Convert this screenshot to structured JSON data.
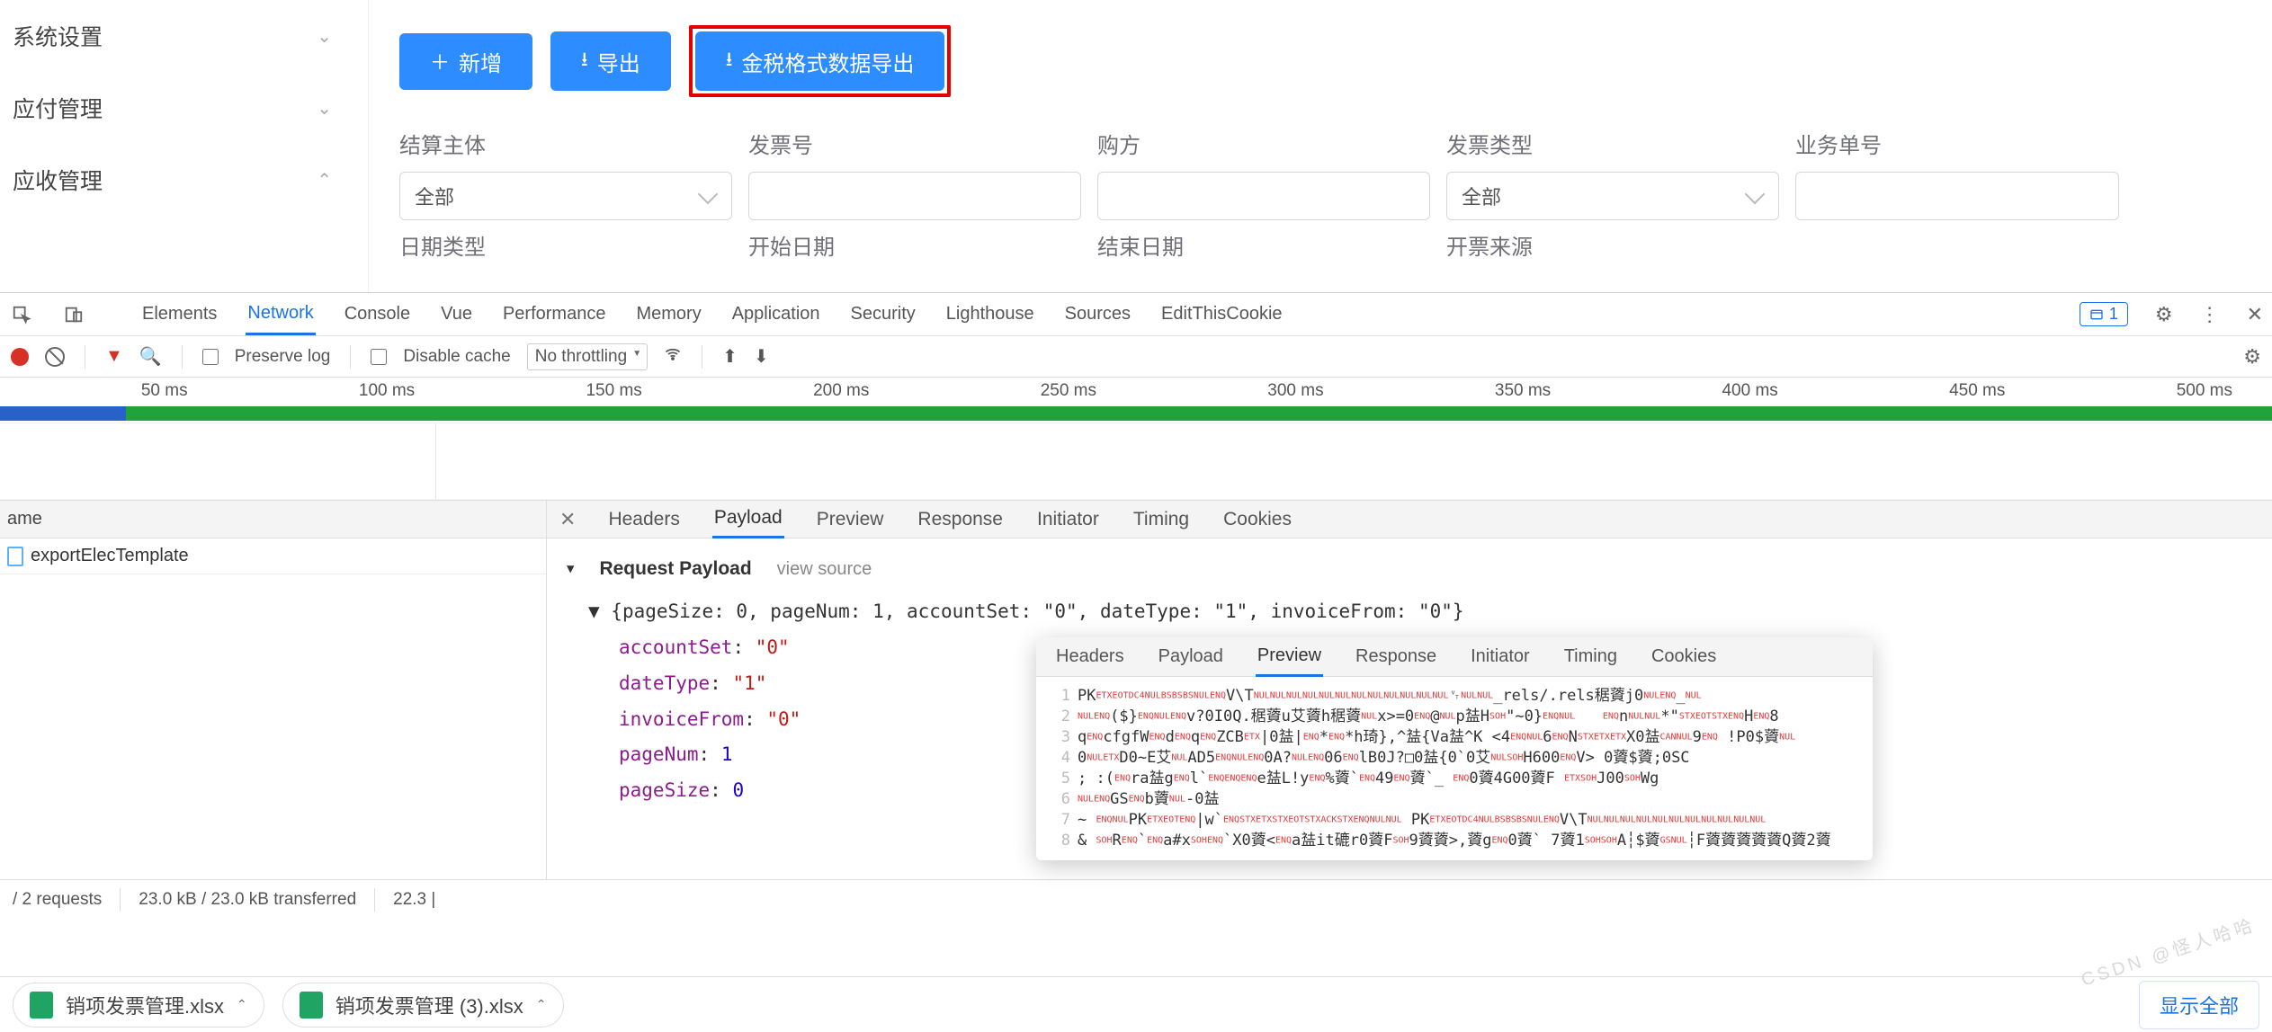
{
  "sidebar": {
    "items": [
      {
        "label": "系统设置",
        "expanded": false
      },
      {
        "label": "应付管理",
        "expanded": false
      },
      {
        "label": "应收管理",
        "expanded": true
      }
    ]
  },
  "toolbar": {
    "new_label": "新增",
    "export_label": "导出",
    "export_tax_label": "金税格式数据导出"
  },
  "filters": {
    "settle_entity": {
      "label": "结算主体",
      "value": "全部"
    },
    "invoice_no": {
      "label": "发票号",
      "value": ""
    },
    "buyer": {
      "label": "购方",
      "value": ""
    },
    "invoice_type": {
      "label": "发票类型",
      "value": "全部"
    },
    "biz_order_no": {
      "label": "业务单号",
      "value": ""
    },
    "date_type": {
      "label": "日期类型",
      "value": ""
    },
    "start_date": {
      "label": "开始日期",
      "value": ""
    },
    "end_date": {
      "label": "结束日期",
      "value": ""
    },
    "invoice_source": {
      "label": "开票来源",
      "value": ""
    }
  },
  "devtools": {
    "tabs": [
      "Elements",
      "Network",
      "Console",
      "Vue",
      "Performance",
      "Memory",
      "Application",
      "Security",
      "Lighthouse",
      "Sources",
      "EditThisCookie"
    ],
    "active_tab": "Network",
    "issues_count": "1",
    "subbar": {
      "preserve_log": "Preserve log",
      "disable_cache": "Disable cache",
      "throttling": "No throttling"
    },
    "timeline_labels": [
      "50 ms",
      "100 ms",
      "150 ms",
      "200 ms",
      "250 ms",
      "300 ms",
      "350 ms",
      "400 ms",
      "450 ms",
      "500 ms"
    ]
  },
  "request_list": {
    "header": "ame",
    "items": [
      {
        "name": "exportElecTemplate"
      }
    ]
  },
  "detail": {
    "tabs": [
      "Headers",
      "Payload",
      "Preview",
      "Response",
      "Initiator",
      "Timing",
      "Cookies"
    ],
    "active_tab": "Payload",
    "section_title": "Request Payload",
    "view_source": "view source",
    "summary": "{pageSize: 0, pageNum: 1, accountSet: \"0\", dateType: \"1\", invoiceFrom: \"0\"}",
    "kv": [
      {
        "key": "accountSet",
        "val": "\"0\"",
        "type": "str"
      },
      {
        "key": "dateType",
        "val": "\"1\"",
        "type": "str"
      },
      {
        "key": "invoiceFrom",
        "val": "\"0\"",
        "type": "str"
      },
      {
        "key": "pageNum",
        "val": "1",
        "type": "num"
      },
      {
        "key": "pageSize",
        "val": "0",
        "type": "num"
      }
    ]
  },
  "preview_popup": {
    "tabs": [
      "Headers",
      "Payload",
      "Preview",
      "Response",
      "Initiator",
      "Timing",
      "Cookies"
    ],
    "active_tab": "Preview",
    "lines": [
      "PK␃␄␔␀␈␈␈␀␅V\\T␀␀␀␀␀␀␀␀␀␀␀␀␋␀␀_rels/.rels䅕薋j0␀␅_␀",
      "␀␅($}␅␀␅v?0I0Q.䅕薋u艾薋h䅕薋␀x>=0␅@␀p䀅H␁\"~0}␅␀   ␅n␀␀*\"␂␄␂␅H␅8",
      "q␅cfgfW␅d␅q␅ZCB␃|0䀅|␅*␅*h琦},^䀅{Va䀅^K <4␅␀6␅N␂␃␃X0䀅␘␀9␅ !P0$薋␀",
      "0␀␃D0~E艾␀AD5␅␀␅0A?␀␅06␅lB0J?□0䀅{0`0艾␀␁H600␅V> 0薋$薋;0SC",
      "; :(␅ra䀅g␅l`␅␅␅e䀅L!y␅%薋`␅49␅薋`_ ␅0薋4G00薋F ␃␁J00␁Wg",
      "␀␅GS␅b薋␀-0䀅",
      "~ ␅␀PK␃␄␅|w`␅␂␃␂␄␂␆␂␅␀␀ PK␃␄␔␀␈␈␈␀␅V\\T␀␀␀␀␀␀␀␀␀␀␀",
      "& ␁R␅`␅a#x␁␅`X0薋<␅a䀅it䃙r0薋F␁9薋薋>,薋g␅0薋` 7薋1␁␁A┆$薋␝␀┆F薋薋薋薋薋Q薋2薋"
    ]
  },
  "status": {
    "requests": "/ 2 requests",
    "transferred": "23.0 kB / 23.0 kB transferred",
    "resources_partial": "22.3 |"
  },
  "downloads": {
    "items": [
      {
        "name": "销项发票管理.xlsx"
      },
      {
        "name": "销项发票管理 (3).xlsx"
      }
    ],
    "show_all": "显示全部"
  },
  "watermark": "CSDN @怪人哈哈"
}
